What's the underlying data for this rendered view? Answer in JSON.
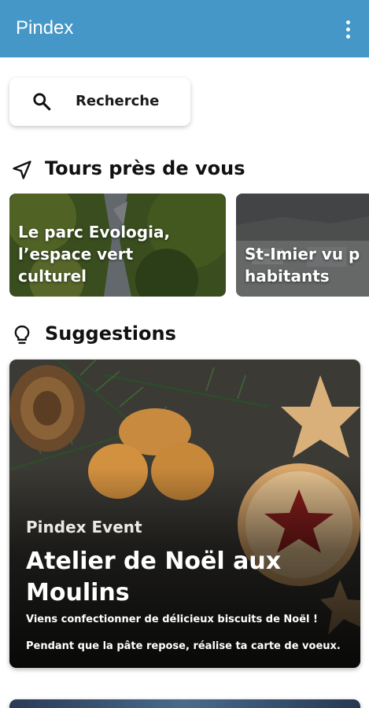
{
  "app": {
    "title": "Pindex",
    "accent_color": "#4497c7",
    "menu_icon": "more-vert-icon"
  },
  "search": {
    "label": "Recherche",
    "icon": "search-icon"
  },
  "tours_section": {
    "title": "Tours près de vous",
    "icon": "navigation-arrow-icon",
    "cards": [
      {
        "title": "Le parc Evologia,\nl’espace vert\nculturel"
      },
      {
        "title": "St-Imier vu p\nhabitants"
      }
    ]
  },
  "suggestions_section": {
    "title": "Suggestions",
    "icon": "lightbulb-icon",
    "card": {
      "kicker": "Pindex Event",
      "title": "Atelier de Noël aux Moulins",
      "line1": "Viens confectionner de délicieux biscuits de Noël !",
      "line2": "Pendant que la pâte repose, réalise ta carte de voeux."
    }
  }
}
